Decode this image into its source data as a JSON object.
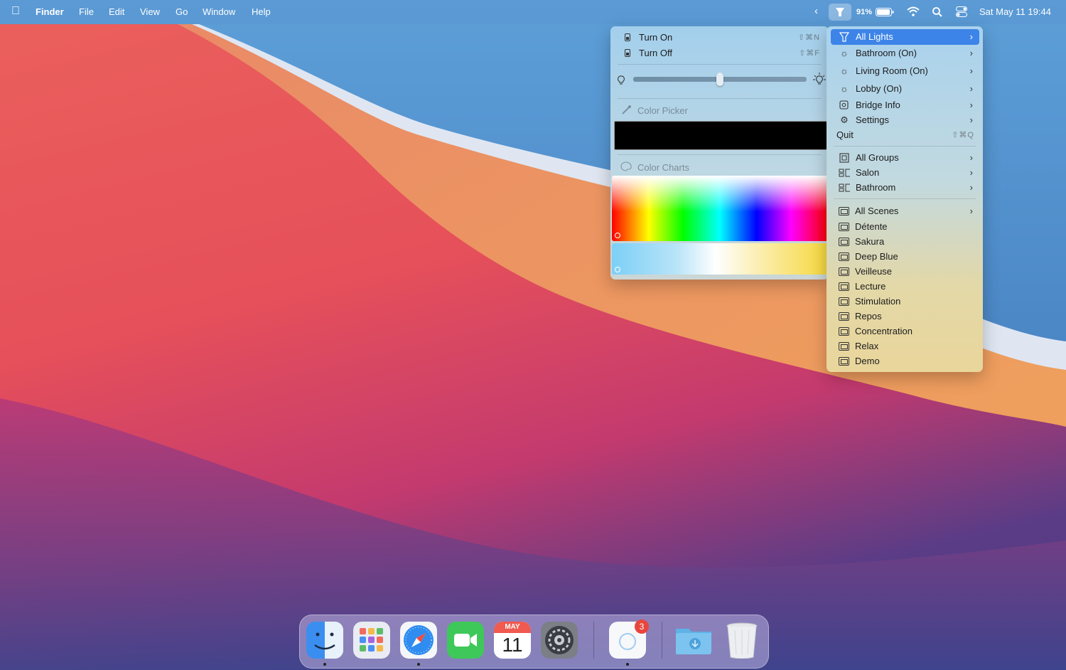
{
  "menubar": {
    "apple": "",
    "app_name": "Finder",
    "menus": [
      "File",
      "Edit",
      "View",
      "Go",
      "Window",
      "Help"
    ],
    "battery": "91%",
    "datetime": "Sat May 11  19:44",
    "icons": [
      "chevron-left-icon",
      "lamp-icon",
      "battery-icon",
      "wifi-icon",
      "search-icon",
      "control-center-icon"
    ]
  },
  "submenu": {
    "turn_on": "Turn On",
    "turn_on_shortcut": "⇧⌘N",
    "turn_off": "Turn Off",
    "turn_off_shortcut": "⇧⌘F",
    "brightness_level": 0.5,
    "color_picker_label": "Color Picker",
    "swatch_color": "#000000",
    "color_charts_label": "Color Charts"
  },
  "mainmenu": {
    "quit_label": "Quit",
    "quit_shortcut": "⇧⌘Q",
    "lights": [
      {
        "label": "All Lights",
        "icon": "lamp-icon",
        "highlighted": true
      },
      {
        "label": "Bathroom (On)",
        "icon": "bulb-icon"
      },
      {
        "label": "Living Room (On)",
        "icon": "bulb-icon"
      },
      {
        "label": "Lobby (On)",
        "icon": "bulb-icon"
      },
      {
        "label": "Bridge Info",
        "icon": "bridge-icon"
      },
      {
        "label": "Settings",
        "icon": "gear-icon"
      }
    ],
    "groups": [
      {
        "label": "All Groups",
        "icon": "group-icon"
      },
      {
        "label": "Salon",
        "icon": "group-icon"
      },
      {
        "label": "Bathroom",
        "icon": "group-icon"
      }
    ],
    "scenes": [
      "All Scenes",
      "Détente",
      "Sakura",
      "Deep Blue",
      "Veilleuse",
      "Lecture",
      "Stimulation",
      "Repos",
      "Concentration",
      "Relax",
      "Demo"
    ]
  },
  "dock": {
    "items": [
      "finder-icon",
      "launchpad-icon",
      "safari-icon",
      "facetime-icon",
      "calendar-icon",
      "system-preferences-icon",
      "app-icon",
      "downloads-folder-icon",
      "trash-icon"
    ],
    "calendar_month": "MAY",
    "calendar_day": "11",
    "badge": "3"
  },
  "colors": {
    "highlight": "#3d84e8",
    "badge": "#e8453c"
  }
}
